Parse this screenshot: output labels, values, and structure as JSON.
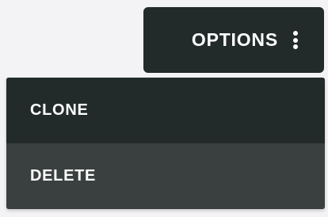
{
  "options_button": {
    "label": "OPTIONS",
    "icon": "more-vertical-icon"
  },
  "dropdown_menu": {
    "items": [
      {
        "label": "CLONE",
        "state": "normal"
      },
      {
        "label": "DELETE",
        "state": "hovered"
      }
    ]
  },
  "colors": {
    "page_background": "#f3f3f5",
    "button_background": "#222b2a",
    "menu_background": "#222b2a",
    "menu_item_hover_background": "#3a403f",
    "text": "#ffffff"
  }
}
